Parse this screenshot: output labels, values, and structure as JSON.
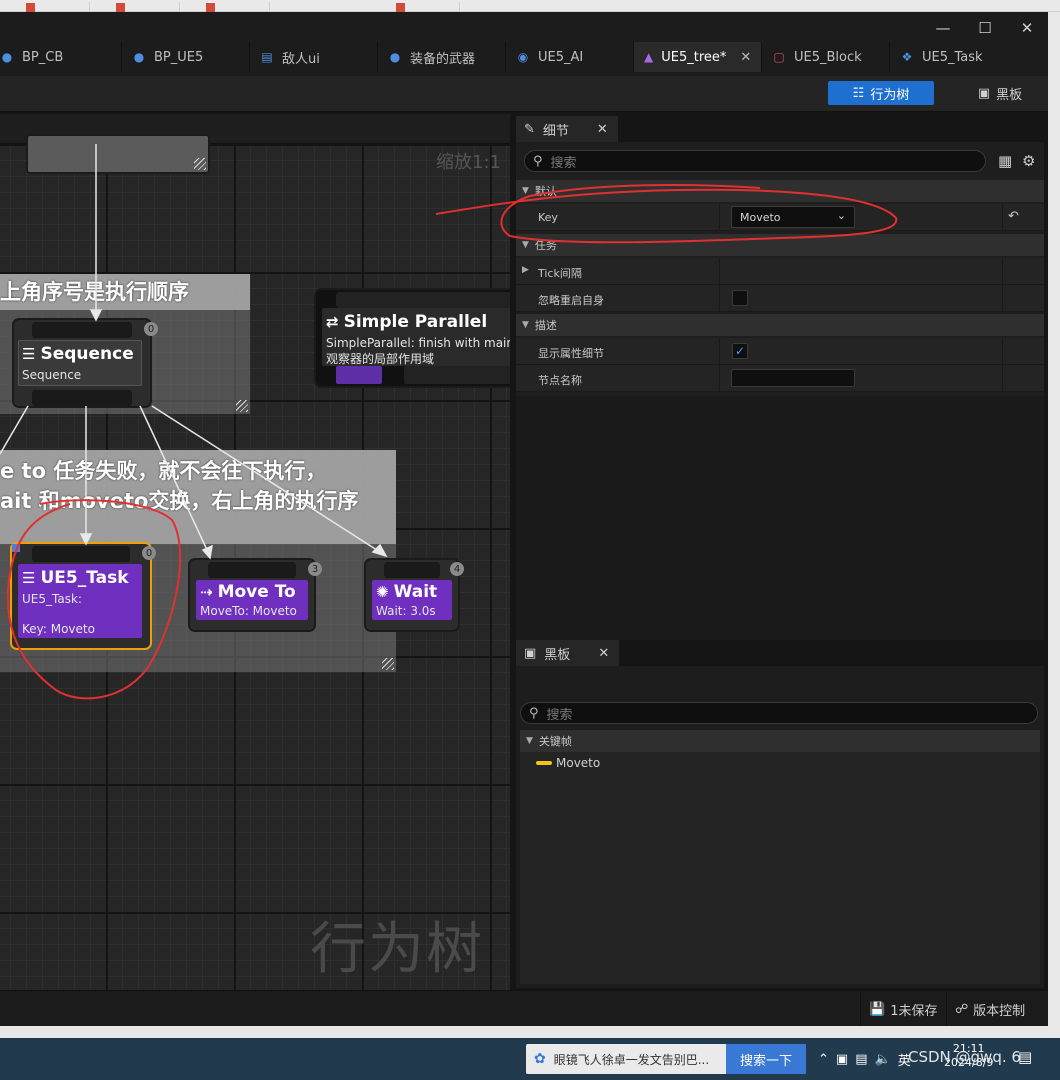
{
  "window": {
    "minimize": "—",
    "maximize": "☐",
    "close": "✕"
  },
  "tabs": [
    {
      "label": "BP_CB",
      "icon": "person-icon"
    },
    {
      "label": "BP_UE5",
      "icon": "person-icon"
    },
    {
      "label": "敌人ui",
      "icon": "widget-icon"
    },
    {
      "label": "装备的武器",
      "icon": "person-icon"
    },
    {
      "label": "UE5_AI",
      "icon": "ai-controller-icon"
    },
    {
      "label": "UE5_tree*",
      "icon": "behavior-tree-icon",
      "active": true,
      "close": "✕"
    },
    {
      "label": "UE5_Block",
      "icon": "blackboard-icon"
    },
    {
      "label": "UE5_Task",
      "icon": "task-icon"
    }
  ],
  "toolbar": {
    "behavior_tree": "行为树",
    "blackboard": "黑板"
  },
  "graph": {
    "zoom": "缩放1:1",
    "watermark": "行为树",
    "comment1_title": "上角序号是执行顺序",
    "comment2_line1": "e to 任务失败，就不会往下执行，",
    "comment2_line2": "ait 和moveto交换，右上角的执行序",
    "nodes": {
      "sequence": {
        "title": "Sequence",
        "subtitle": "Sequence",
        "order": "0"
      },
      "simple_parallel": {
        "title": "Simple Parallel",
        "line1": "SimpleParallel: finish with main t",
        "line2": "观察器的局部作用域"
      },
      "ue5_task": {
        "title": "UE5_Task",
        "line1": "UE5_Task:",
        "line2": "Key: Moveto",
        "order": "0"
      },
      "move_to": {
        "title": "Move To",
        "subtitle": "MoveTo: Moveto",
        "order": "3"
      },
      "wait": {
        "title": "Wait",
        "subtitle": "Wait: 3.0s",
        "order": "4"
      }
    }
  },
  "details": {
    "tab": "细节",
    "close": "✕",
    "search_placeholder": "搜索",
    "sections": {
      "default": "默认",
      "task": "任务",
      "description": "描述"
    },
    "rows": {
      "key_label": "Key",
      "key_value": "Moveto",
      "tick_label": "Tick间隔",
      "ignore_restart_label": "忽略重启自身",
      "ignore_restart": false,
      "show_details_label": "显示属性细节",
      "show_details": true,
      "node_name_label": "节点名称",
      "node_name_value": ""
    }
  },
  "blackboard": {
    "tab": "黑板",
    "close": "✕",
    "search_placeholder": "搜索",
    "section": "关键帧",
    "entries": [
      {
        "name": "Moveto",
        "color": "#f5c21b"
      }
    ]
  },
  "statusbar": {
    "unsaved": "1未保存",
    "source_control": "版本控制"
  },
  "taskbar": {
    "search_text": "眼镜飞人徐卓一发文告别巴...",
    "search_button": "搜索一下",
    "ime": "英",
    "time": "21:11",
    "date": "2024/8/9",
    "overlay_mark": "CSDN @gwq. 6"
  },
  "colors": {
    "accent": "#1f6fd1",
    "task_purple": "#6f2fbf",
    "annotation_red": "#e03030",
    "selection_orange": "#f0a000"
  }
}
